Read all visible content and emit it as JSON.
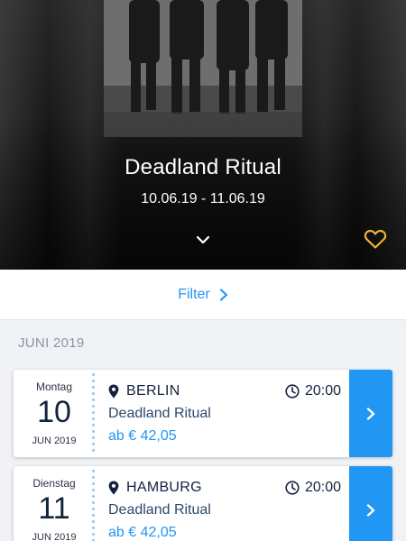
{
  "hero": {
    "title": "Deadland Ritual",
    "dates": "10.06.19 - 11.06.19",
    "icons": {
      "expand": "chevron-down-icon",
      "favorite": "heart-outline-icon"
    },
    "favorite_color": "#f2b233"
  },
  "filter": {
    "label": "Filter",
    "icon": "chevron-right-icon",
    "color": "#2196f3"
  },
  "month_header": "JUNI 2019",
  "events": [
    {
      "weekday": "Montag",
      "day": "10",
      "month_year": "JUN 2019",
      "city": "BERLIN",
      "time": "20:00",
      "act": "Deadland Ritual",
      "price": "ab € 42,05"
    },
    {
      "weekday": "Dienstag",
      "day": "11",
      "month_year": "JUN 2019",
      "city": "HAMBURG",
      "time": "20:00",
      "act": "Deadland Ritual",
      "price": "ab € 42,05"
    }
  ],
  "colors": {
    "accent": "#2196f3",
    "background": "#f0f2f6",
    "text_dark": "#12233d"
  }
}
